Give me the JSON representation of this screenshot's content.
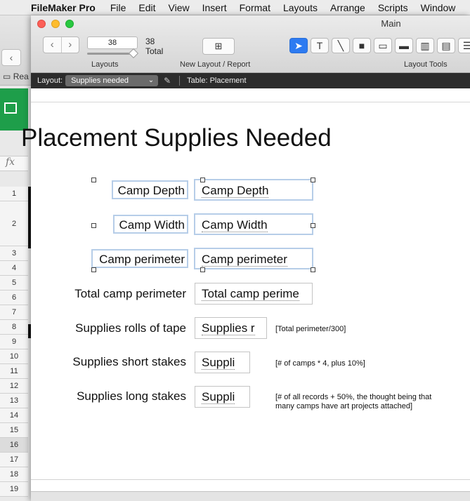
{
  "menubar": {
    "app_name": "FileMaker Pro",
    "items": [
      "File",
      "Edit",
      "View",
      "Insert",
      "Format",
      "Layouts",
      "Arrange",
      "Scripts",
      "Window"
    ]
  },
  "background_app": {
    "folder_label": "Rea",
    "fx_label": "fx",
    "row_numbers": [
      "1",
      "2",
      "3",
      "4",
      "5",
      "6",
      "7",
      "8",
      "9",
      "10",
      "11",
      "12",
      "13",
      "14",
      "15",
      "16",
      "17",
      "18",
      "19"
    ]
  },
  "window": {
    "title": "Main",
    "layout_number": "38",
    "total_count": "38",
    "total_label": "Total",
    "layouts_label": "Layouts",
    "new_layout_label": "New Layout / Report",
    "layout_tools_label": "Layout Tools"
  },
  "layout_bar": {
    "layout_label": "Layout:",
    "layout_value": "Supplies needed",
    "table_label": "Table: Placement"
  },
  "canvas": {
    "title": "Placement Supplies Needed",
    "rows": [
      {
        "label": "Camp Depth",
        "field": "Camp Depth"
      },
      {
        "label": "Camp Width",
        "field": "Camp Width"
      },
      {
        "label": "Camp perimeter",
        "field": "Camp perimeter"
      },
      {
        "label": "Total camp perimeter",
        "field": "Total camp perime"
      },
      {
        "label": "Supplies rolls of tape",
        "field": "Supplies r",
        "note": "[Total perimeter/300]"
      },
      {
        "label": "Supplies short stakes",
        "field": "Suppli",
        "note": "[# of camps * 4, plus 10%]"
      },
      {
        "label": "Supplies long stakes",
        "field": "Suppli",
        "note": "[# of all records + 50%, the thought being that many camps have art projects attached]"
      }
    ]
  }
}
